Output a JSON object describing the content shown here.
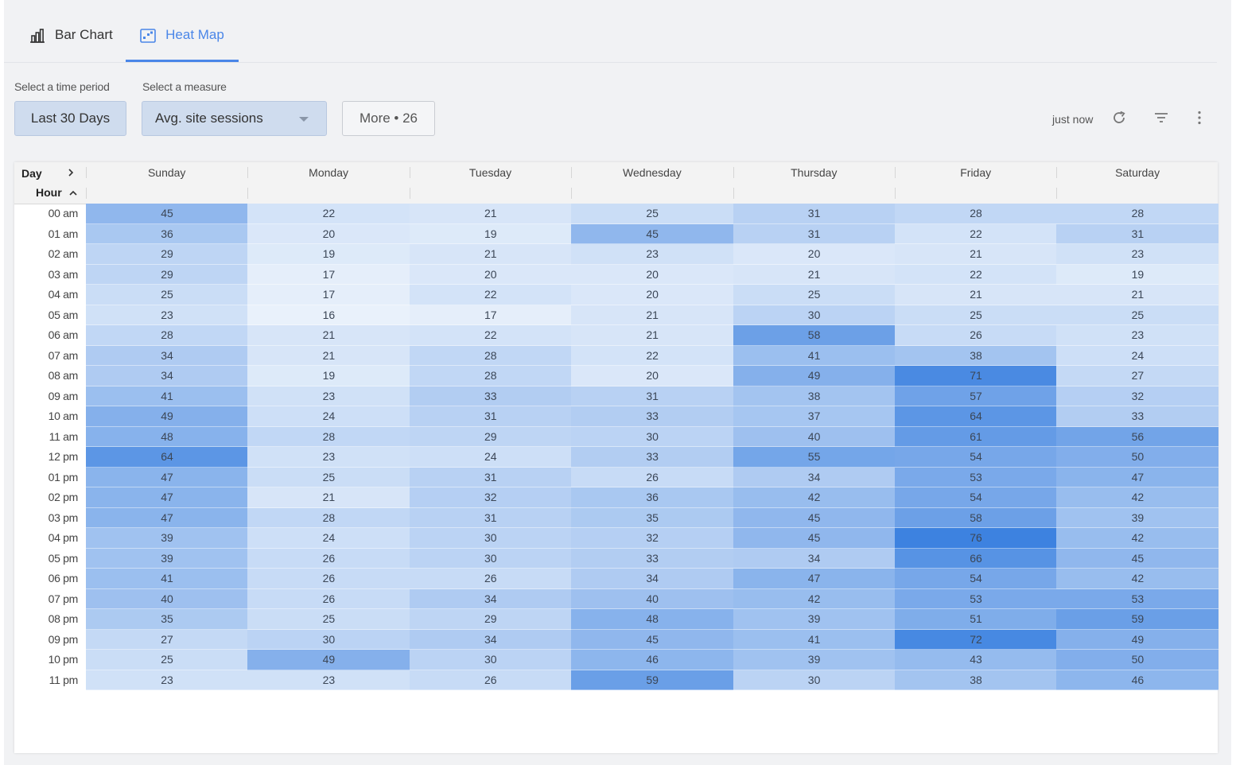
{
  "tabs": [
    {
      "label": "Bar Chart",
      "icon": "bar-chart-icon"
    },
    {
      "label": "Heat Map",
      "icon": "heat-map-icon",
      "active": true
    }
  ],
  "filters": {
    "period_label": "Select a time period",
    "period_value": "Last 30 Days",
    "measure_label": "Select a measure",
    "measure_value": "Avg. site sessions",
    "more_label": "More • 26"
  },
  "toolbar": {
    "updated": "just now",
    "icons": [
      "refresh-icon",
      "filter-icon",
      "more-vertical-icon"
    ]
  },
  "colors": {
    "accent": "#4a86e8",
    "scale_low": "#e9f1fb",
    "scale_high": "#3d82e0"
  },
  "chart_data": {
    "type": "heatmap",
    "column_axis_label": "Day",
    "row_axis_label": "Hour",
    "columns": [
      "Sunday",
      "Monday",
      "Tuesday",
      "Wednesday",
      "Thursday",
      "Friday",
      "Saturday"
    ],
    "rows": [
      "00 am",
      "01 am",
      "02 am",
      "03 am",
      "04 am",
      "05 am",
      "06 am",
      "07 am",
      "08 am",
      "09 am",
      "10 am",
      "11 am",
      "12 pm",
      "01 pm",
      "02 pm",
      "03 pm",
      "04 pm",
      "05 pm",
      "06 pm",
      "07 pm",
      "08 pm",
      "09 pm",
      "10 pm",
      "11 pm"
    ],
    "values": [
      [
        45,
        22,
        21,
        25,
        31,
        28,
        28
      ],
      [
        36,
        20,
        19,
        45,
        31,
        22,
        31
      ],
      [
        29,
        19,
        21,
        23,
        20,
        21,
        23
      ],
      [
        29,
        17,
        20,
        20,
        21,
        22,
        19
      ],
      [
        25,
        17,
        22,
        20,
        25,
        21,
        21
      ],
      [
        23,
        16,
        17,
        21,
        30,
        25,
        25
      ],
      [
        28,
        21,
        22,
        21,
        58,
        26,
        23
      ],
      [
        34,
        21,
        28,
        22,
        41,
        38,
        24
      ],
      [
        34,
        19,
        28,
        20,
        49,
        71,
        27
      ],
      [
        41,
        23,
        33,
        31,
        38,
        57,
        32
      ],
      [
        49,
        24,
        31,
        33,
        37,
        64,
        33
      ],
      [
        48,
        28,
        29,
        30,
        40,
        61,
        56
      ],
      [
        64,
        23,
        24,
        33,
        55,
        54,
        50
      ],
      [
        47,
        25,
        31,
        26,
        34,
        53,
        47
      ],
      [
        47,
        21,
        32,
        36,
        42,
        54,
        42
      ],
      [
        47,
        28,
        31,
        35,
        45,
        58,
        39
      ],
      [
        39,
        24,
        30,
        32,
        45,
        76,
        42
      ],
      [
        39,
        26,
        30,
        33,
        34,
        66,
        45
      ],
      [
        41,
        26,
        26,
        34,
        47,
        54,
        42
      ],
      [
        40,
        26,
        34,
        40,
        42,
        53,
        53
      ],
      [
        35,
        25,
        29,
        48,
        39,
        51,
        59
      ],
      [
        27,
        30,
        34,
        45,
        41,
        72,
        49
      ],
      [
        25,
        49,
        30,
        46,
        39,
        43,
        50
      ],
      [
        23,
        23,
        26,
        59,
        30,
        38,
        46
      ]
    ]
  }
}
